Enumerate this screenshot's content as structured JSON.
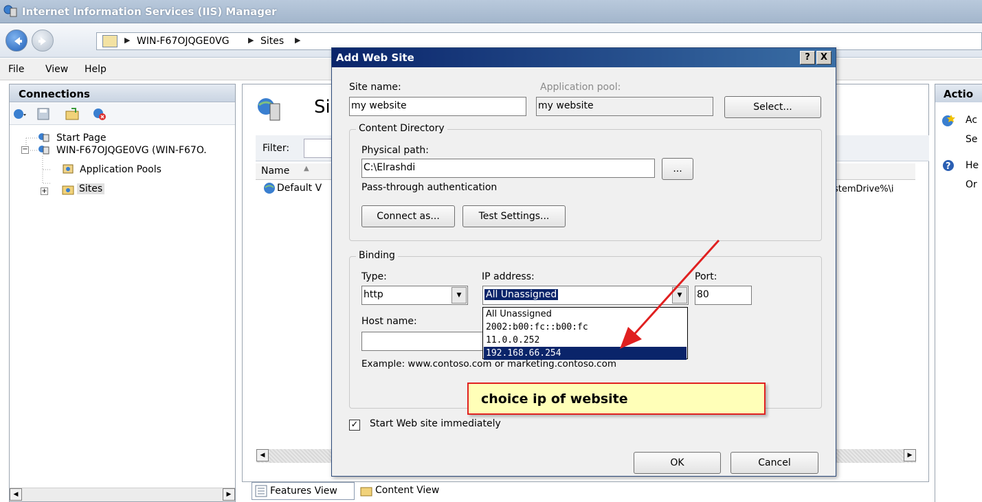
{
  "window": {
    "title": "Internet Information Services (IIS) Manager"
  },
  "address_bar": {
    "crumbs": [
      "WIN-F67OJQGE0VG",
      "Sites"
    ]
  },
  "menu": {
    "items": [
      "File",
      "View",
      "Help"
    ]
  },
  "connections": {
    "header": "Connections",
    "tree": {
      "start_page": "Start Page",
      "server": "WIN-F67OJQGE0VG (WIN-F67O.",
      "app_pools": "Application Pools",
      "sites": "Sites"
    }
  },
  "center": {
    "heading_partial": "Si",
    "filter_label": "Filter:",
    "column_name": "Name",
    "row_default": "Default V",
    "row_path_partial": "stemDrive%\\i",
    "features_view": "Features View",
    "content_view": "Content View"
  },
  "actions": {
    "header_partial": "Actio",
    "items": [
      "Ac",
      "Se",
      "He",
      "Or"
    ]
  },
  "dialog": {
    "title": "Add Web Site",
    "help_btn": "?",
    "close_btn": "X",
    "site_name_label": "Site name:",
    "site_name_value": "my website",
    "app_pool_label": "Application pool:",
    "app_pool_value": "my website",
    "select_button": "Select...",
    "content_group": "Content Directory",
    "physical_path_label": "Physical path:",
    "physical_path_value": "C:\\Elrashdi",
    "browse_button": "...",
    "passthrough_label": "Pass-through authentication",
    "connect_as_button": "Connect as...",
    "test_settings_button": "Test Settings...",
    "binding_group": "Binding",
    "type_label": "Type:",
    "type_value": "http",
    "ip_label": "IP address:",
    "ip_value": "All Unassigned",
    "port_label": "Port:",
    "port_value": "80",
    "host_label": "Host name:",
    "host_value": "",
    "example_text": "Example: www.contoso.com or marketing.contoso.com",
    "ip_options": [
      "All Unassigned",
      "2002:b00:fc::b00:fc",
      "11.0.0.252",
      "192.168.66.254"
    ],
    "start_immediately_label": "Start Web site immediately",
    "start_immediately_checked": true,
    "ok_button": "OK",
    "cancel_button": "Cancel"
  },
  "annotation": {
    "text": "choice ip of website",
    "color": "#e02020"
  }
}
